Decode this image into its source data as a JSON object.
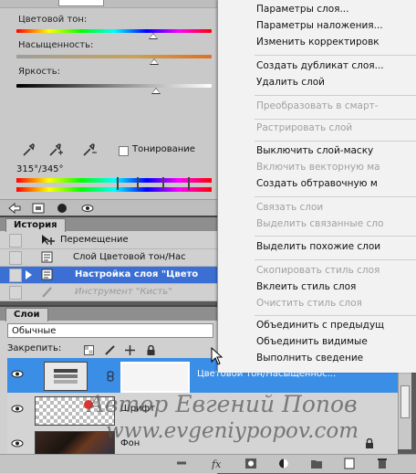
{
  "adjustments": {
    "hue_label": "Цветовой тон:",
    "saturation_label": "Насыщенность:",
    "lightness_label": "Яркость:",
    "colorize_label": "Тонирование",
    "range_label": "315°/345°"
  },
  "history": {
    "tab_label": "История",
    "items": [
      {
        "label": "Перемещение"
      },
      {
        "label": "Слой Цветовой тон/Нас"
      },
      {
        "label": "Настройка слоя \"Цвето"
      },
      {
        "label": "Инструмент \"Кисть\""
      }
    ]
  },
  "layers": {
    "tab_label": "Слои",
    "blend_mode": "Обычные",
    "lock_label": "Закрепить:",
    "items": [
      {
        "name": "Цветовой тон/Насыщенноc..."
      },
      {
        "name": "Шрифт"
      },
      {
        "name": "Фон"
      }
    ]
  },
  "context_menu": {
    "items": [
      {
        "label": "Параметры слоя...",
        "enabled": true
      },
      {
        "label": "Параметры наложения...",
        "enabled": true
      },
      {
        "label": "Изменить корректировк",
        "enabled": true
      },
      {
        "label": "Создать дубликат слоя...",
        "enabled": true
      },
      {
        "label": "Удалить слой",
        "enabled": true
      },
      {
        "label": "Преобразовать в смарт-",
        "enabled": false
      },
      {
        "label": "Растрировать слой",
        "enabled": false
      },
      {
        "label": "Выключить слой-маску",
        "enabled": true
      },
      {
        "label": "Включить векторную ма",
        "enabled": false
      },
      {
        "label": "Создать обтравочную м",
        "enabled": true
      },
      {
        "label": "Связать слои",
        "enabled": false
      },
      {
        "label": "Выделить связанные сло",
        "enabled": false
      },
      {
        "label": "Выделить похожие слои",
        "enabled": true
      },
      {
        "label": "Скопировать стиль слоя",
        "enabled": false
      },
      {
        "label": "Вклеить стиль слоя",
        "enabled": true
      },
      {
        "label": "Очистить стиль слоя",
        "enabled": false
      },
      {
        "label": "Объединить с предыдущ",
        "enabled": true
      },
      {
        "label": "Объединить видимые",
        "enabled": true
      },
      {
        "label": "Выполнить сведение",
        "enabled": true
      }
    ]
  },
  "watermark": {
    "line1": "Автор Евгений Попов",
    "line2": "www.evgeniypopov.com"
  },
  "colors": {
    "selection_blue": "#3b6fd4",
    "layer_selected": "#3a8ee6",
    "menu_bg": "#f2f2f2",
    "panel_bg": "#c9c9c9"
  }
}
